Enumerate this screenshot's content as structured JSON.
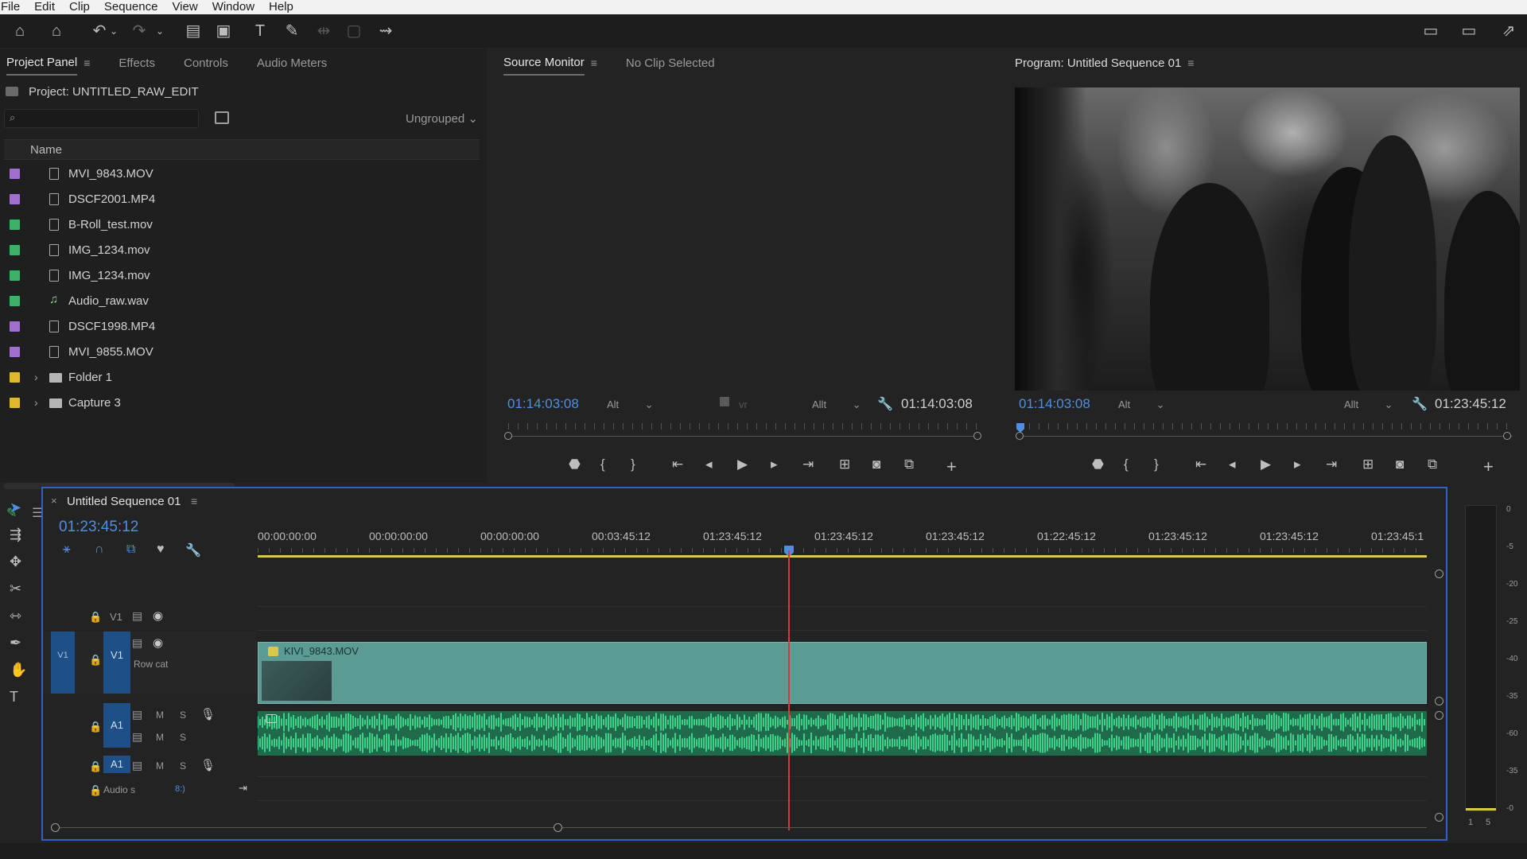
{
  "menu": [
    "File",
    "Edit",
    "Clip",
    "Sequence",
    "View",
    "Window",
    "Help"
  ],
  "project_panel": {
    "tabs": [
      "Project Panel",
      "Effects",
      "Controls",
      "Audio Meters"
    ],
    "title": "Project: UNTITLED_RAW_EDIT",
    "search_placeholder": "",
    "grouping": "Ungrouped",
    "column_name": "Name",
    "items": [
      {
        "name": "MVI_9843.MOV",
        "color": "#a070d0",
        "kind": "video"
      },
      {
        "name": "DSCF2001.MP4",
        "color": "#a070d0",
        "kind": "video"
      },
      {
        "name": "B-Roll_test.mov",
        "color": "#3fb06a",
        "kind": "video"
      },
      {
        "name": "IMG_1234.mov",
        "color": "#3fb06a",
        "kind": "video"
      },
      {
        "name": "IMG_1234.mov",
        "color": "#3fb06a",
        "kind": "video"
      },
      {
        "name": "Audio_raw.wav",
        "color": "#3fb06a",
        "kind": "audio"
      },
      {
        "name": "DSCF1998.MP4",
        "color": "#a070d0",
        "kind": "video"
      },
      {
        "name": "MVI_9855.MOV",
        "color": "#a070d0",
        "kind": "video"
      },
      {
        "name": "Folder 1",
        "color": "#e0b830",
        "kind": "folder"
      },
      {
        "name": "Capture 3",
        "color": "#e0b830",
        "kind": "folder"
      }
    ]
  },
  "source_monitor": {
    "tab": "Source Monitor",
    "status": "No Clip Selected",
    "timecode_in": "01:14:03:08",
    "fit": "Alt",
    "resolution": "Allt",
    "timecode_out": "01:14:03:08"
  },
  "program_monitor": {
    "title": "Program: Untitled Sequence 01",
    "timecode_in": "01:14:03:08",
    "fit": "Alt",
    "resolution": "Allt",
    "timecode_out": "01:23:45:12"
  },
  "timeline": {
    "title": "Untitled Sequence 01",
    "timecode": "01:23:45:12",
    "ruler": [
      "00:00:00:00",
      "00:00:00:00",
      "00:00:00:00",
      "00:03:45:12",
      "01:23:45:12",
      "01:23:45:12",
      "01:23:45:12",
      "01:22:45:12",
      "01:23:45:12",
      "01:23:45:12",
      "01:23:45:1"
    ],
    "tracks": {
      "v1_top": "V1",
      "v1_src": "V1",
      "v1": "V1",
      "v1_name": "Row cat",
      "a1": "A1",
      "a1b": "A1",
      "mix_label": "Audio s",
      "mix_value": "8:)"
    },
    "clip_name": "KIVI_9843.MOV"
  },
  "meters": {
    "scale": [
      "0",
      "-5",
      "-20",
      "-25",
      "-40",
      "-35",
      "-60",
      "-35",
      "-0"
    ],
    "channels": [
      "1",
      "5"
    ]
  }
}
